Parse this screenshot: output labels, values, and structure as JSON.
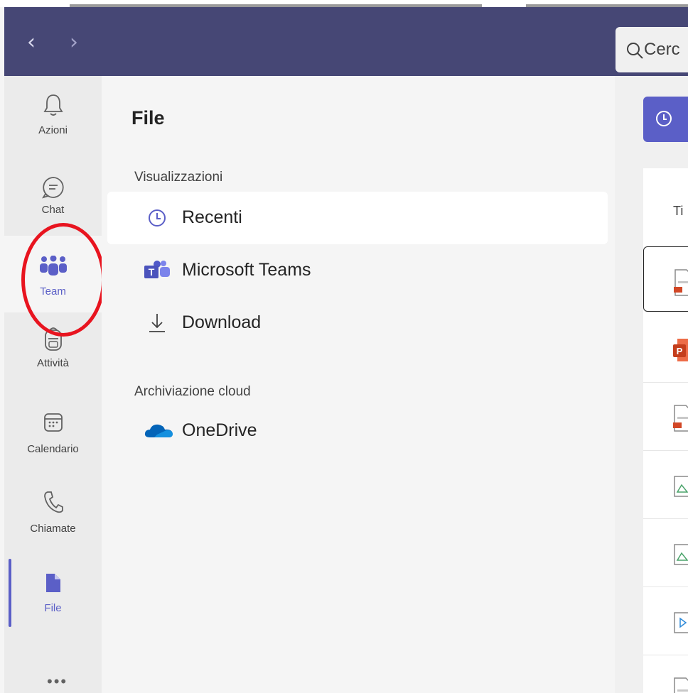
{
  "search": {
    "text": "Cerc"
  },
  "rail": {
    "items": [
      {
        "label": "Azioni",
        "icon": "bell-icon"
      },
      {
        "label": "Chat",
        "icon": "chat-icon"
      },
      {
        "label": "Team",
        "icon": "teams-icon"
      },
      {
        "label": "Attività",
        "icon": "backpack-icon"
      },
      {
        "label": "Calendario",
        "icon": "calendar-icon"
      },
      {
        "label": "Chiamate",
        "icon": "phone-icon"
      },
      {
        "label": "File",
        "icon": "file-icon"
      }
    ],
    "more": "•••"
  },
  "files_pane": {
    "title": "File",
    "views_heading": "Visualizzazioni",
    "views": [
      {
        "label": "Recenti",
        "icon": "clock-icon"
      },
      {
        "label": "Microsoft Teams",
        "icon": "teams-logo-icon"
      },
      {
        "label": "Download",
        "icon": "download-icon"
      }
    ],
    "cloud_heading": "Archiviazione cloud",
    "cloud": [
      {
        "label": "OneDrive",
        "icon": "onedrive-icon"
      }
    ]
  },
  "content": {
    "column_header": "Ti"
  },
  "colors": {
    "titlebar": "#464775",
    "accent": "#5b5fc7",
    "annotation": "#e8141f"
  }
}
